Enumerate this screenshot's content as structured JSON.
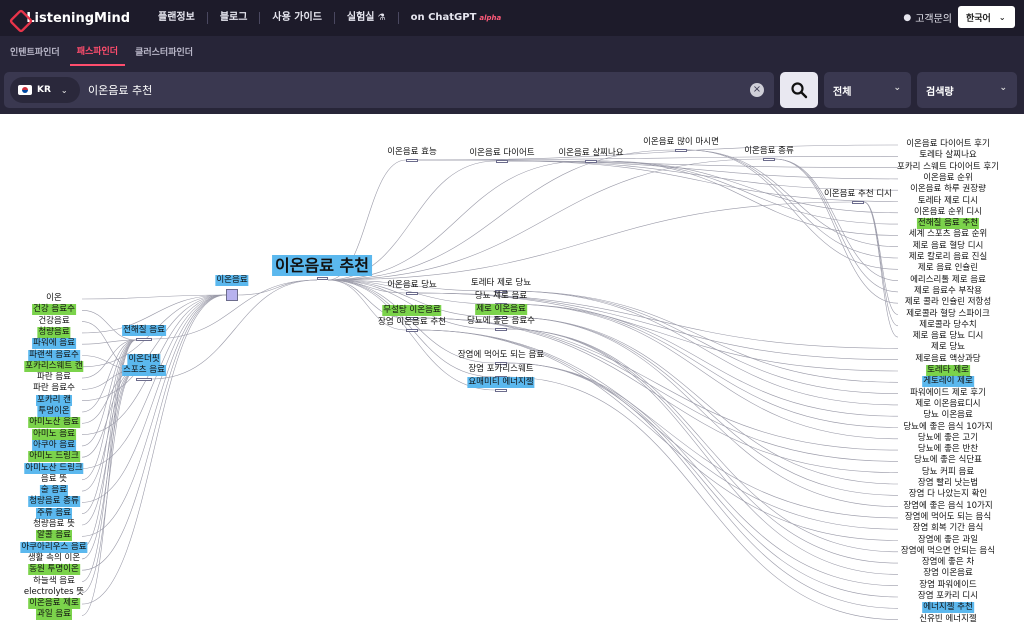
{
  "header": {
    "logo_text": "ListeningMind",
    "nav": [
      "플랜정보",
      "블로그",
      "사용 가이드",
      "실험실",
      "on ChatGPT"
    ],
    "alpha_badge": "alpha",
    "contact": "고객문의",
    "language": "한국어"
  },
  "tabs": [
    {
      "label": "인텐트파인더",
      "active": false
    },
    {
      "label": "패스파인더",
      "active": true
    },
    {
      "label": "클러스터파인더",
      "active": false
    }
  ],
  "search": {
    "country": "KR",
    "query": "이온음료 추천",
    "scope": "전체",
    "sort": "검색량"
  },
  "graph": {
    "center": "이온음료 추천",
    "hubs": [
      "이온음료",
      "전해질 음료",
      "이온더핏 스포츠 음료"
    ],
    "left_nodes": [
      {
        "label": "이온",
        "hl": ""
      },
      {
        "label": "건강 음료수",
        "hl": "g"
      },
      {
        "label": "건강음료",
        "hl": ""
      },
      {
        "label": "청량음료",
        "hl": "g"
      },
      {
        "label": "파워에 음료",
        "hl": "b"
      },
      {
        "label": "파랜색 음료수",
        "hl": "b"
      },
      {
        "label": "포카리스웨트 캔",
        "hl": "g"
      },
      {
        "label": "파란 음료",
        "hl": ""
      },
      {
        "label": "파란 음료수",
        "hl": ""
      },
      {
        "label": "포카리 캔",
        "hl": "b"
      },
      {
        "label": "투명이온",
        "hl": "b"
      },
      {
        "label": "아미노산 음료",
        "hl": "g"
      },
      {
        "label": "아미노 음료",
        "hl": "g"
      },
      {
        "label": "아쿠아 음료",
        "hl": "b"
      },
      {
        "label": "아미노 드링크",
        "hl": "g"
      },
      {
        "label": "아미노산 드링크",
        "hl": "b"
      },
      {
        "label": "음료 뜻",
        "hl": ""
      },
      {
        "label": "술 음료",
        "hl": "b"
      },
      {
        "label": "청량음료 종류",
        "hl": "b"
      },
      {
        "label": "주류 음료",
        "hl": "b"
      },
      {
        "label": "청량음료 뜻",
        "hl": ""
      },
      {
        "label": "알콜 음료",
        "hl": "g"
      },
      {
        "label": "아쿠아리우스 음료",
        "hl": "b"
      },
      {
        "label": "생활 속의 이온",
        "hl": ""
      },
      {
        "label": "동원 투명이온",
        "hl": "g"
      },
      {
        "label": "하늘색 음료",
        "hl": ""
      },
      {
        "label": "electrolytes 뜻",
        "hl": ""
      },
      {
        "label": "이온음료 제로",
        "hl": "g"
      },
      {
        "label": "과일 음료",
        "hl": "g"
      }
    ],
    "mid_nodes": [
      {
        "label": "이온음료 효능",
        "hl": ""
      },
      {
        "label": "이온음료 다이어트",
        "hl": ""
      },
      {
        "label": "이온음료 살찌나요",
        "hl": ""
      },
      {
        "label": "이온음료 많이 마시면",
        "hl": ""
      },
      {
        "label": "이온음료 종류",
        "hl": ""
      },
      {
        "label": "이온음료 추천 디시",
        "hl": ""
      },
      {
        "label": "이온음료 당뇨",
        "hl": ""
      },
      {
        "label": "토레타 제로 당뇨",
        "hl": ""
      },
      {
        "label": "당뇨 제로 음료",
        "hl": ""
      },
      {
        "label": "무설탕 이온음료",
        "hl": "g"
      },
      {
        "label": "제로 이온음료",
        "hl": "g"
      },
      {
        "label": "장염 이온음료 추천",
        "hl": ""
      },
      {
        "label": "당뇨에 좋은 음료수",
        "hl": ""
      },
      {
        "label": "장염에 먹어도 되는 음료",
        "hl": ""
      },
      {
        "label": "장염 포카리스웨트",
        "hl": ""
      },
      {
        "label": "요매미티 에너지젤",
        "hl": "b"
      }
    ],
    "right_nodes": [
      {
        "label": "이온음료 다이어트 후기",
        "hl": ""
      },
      {
        "label": "토레타 살찌나요",
        "hl": ""
      },
      {
        "label": "포카리 스웨트 다이어트 후기",
        "hl": ""
      },
      {
        "label": "이온음료 순위",
        "hl": ""
      },
      {
        "label": "이온음료 하루 권장량",
        "hl": ""
      },
      {
        "label": "토레타 제로 디시",
        "hl": ""
      },
      {
        "label": "이온음료 순위 디시",
        "hl": ""
      },
      {
        "label": "전해질 음료 추천",
        "hl": "g"
      },
      {
        "label": "세계 스포츠 음료 순위",
        "hl": ""
      },
      {
        "label": "제로 음료 혈당 디시",
        "hl": ""
      },
      {
        "label": "제로 칼로리 음료 진실",
        "hl": ""
      },
      {
        "label": "제로 음료 인슐린",
        "hl": ""
      },
      {
        "label": "에리스리톨 제로 음료",
        "hl": ""
      },
      {
        "label": "제로 음료수 부작용",
        "hl": ""
      },
      {
        "label": "제로 콜라 인슐린 저항성",
        "hl": ""
      },
      {
        "label": "제로콜라 혈당 스파이크",
        "hl": ""
      },
      {
        "label": "제로콜라 당수치",
        "hl": ""
      },
      {
        "label": "제로 음료 당뇨 디시",
        "hl": ""
      },
      {
        "label": "제로 당뇨",
        "hl": ""
      },
      {
        "label": "제로음료 액상과당",
        "hl": ""
      },
      {
        "label": "토레타 제로",
        "hl": "g"
      },
      {
        "label": "게토레이 제로",
        "hl": "b"
      },
      {
        "label": "파워에이드 제로 후기",
        "hl": ""
      },
      {
        "label": "제로 이온음료디시",
        "hl": ""
      },
      {
        "label": "당뇨 이온음료",
        "hl": ""
      },
      {
        "label": "당뇨에 좋은 음식 10가지",
        "hl": ""
      },
      {
        "label": "당뇨에 좋은 고기",
        "hl": ""
      },
      {
        "label": "당뇨에 좋은 반찬",
        "hl": ""
      },
      {
        "label": "당뇨에 좋은 식단표",
        "hl": ""
      },
      {
        "label": "당뇨 커피 음료",
        "hl": ""
      },
      {
        "label": "장염 빨리 낫는법",
        "hl": ""
      },
      {
        "label": "장염 다 나았는지 확인",
        "hl": ""
      },
      {
        "label": "장염에 좋은 음식 10가지",
        "hl": ""
      },
      {
        "label": "장염에 먹어도 되는 음식",
        "hl": ""
      },
      {
        "label": "장염 회복 기간 음식",
        "hl": ""
      },
      {
        "label": "장염에 좋은 과일",
        "hl": ""
      },
      {
        "label": "장염에 먹으면 안되는 음식",
        "hl": ""
      },
      {
        "label": "장염에 좋은 차",
        "hl": ""
      },
      {
        "label": "장염 이온음료",
        "hl": ""
      },
      {
        "label": "장염 파워에이드",
        "hl": ""
      },
      {
        "label": "장염 포카리 디시",
        "hl": ""
      },
      {
        "label": "에너지젤 추천",
        "hl": "b"
      },
      {
        "label": "신유빈 에너지젤",
        "hl": ""
      }
    ]
  }
}
